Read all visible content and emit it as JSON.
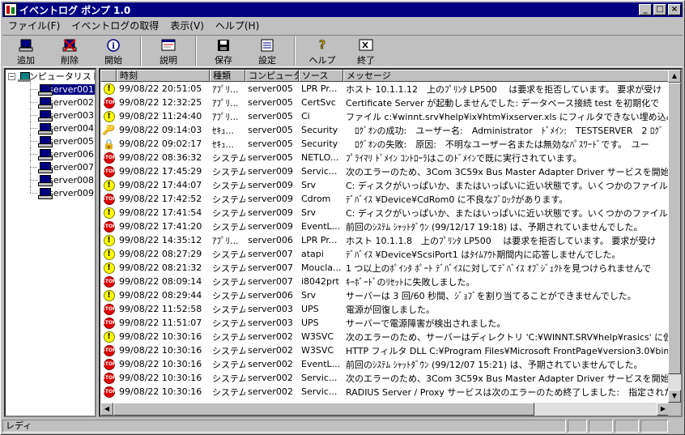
{
  "app": {
    "title": "イベントログ ポンプ 1.0"
  },
  "window_controls": [
    "_",
    "□",
    "×"
  ],
  "menubar": [
    "ファイル(F)",
    "イベントログの取得",
    "表示(V)",
    "ヘルプ(H)"
  ],
  "toolbar": [
    {
      "label": "追加",
      "icon": "add-computer-icon"
    },
    {
      "label": "削除",
      "icon": "delete-computer-icon"
    },
    {
      "label": "開始",
      "icon": "start-info-icon"
    },
    {
      "label": "説明",
      "icon": "description-icon"
    },
    {
      "label": "保存",
      "icon": "save-disk-icon"
    },
    {
      "label": "設定",
      "icon": "settings-icon"
    },
    {
      "label": "ヘルプ",
      "icon": "help-icon"
    },
    {
      "label": "終了",
      "icon": "exit-icon"
    }
  ],
  "tree": {
    "root": "コンピュータリスト",
    "items": [
      "server001",
      "server002",
      "server003",
      "server004",
      "server005",
      "server006",
      "server007",
      "server008",
      "server009"
    ],
    "selected": "server001"
  },
  "columns": [
    "",
    "時刻",
    "種類",
    "コンピュータ名",
    "ソース",
    "メッセージ"
  ],
  "rows": [
    {
      "icon": "warn",
      "time": "99/08/22 20:51:05",
      "type": "ｱﾌﾟﾘ...",
      "computer": "server005",
      "source": "LPR Pr...",
      "message": "ホスト 10.1.1.12　上のﾌﾟﾘﾝﾀ LP500　 は要求を拒否しています。 要求が受け"
    },
    {
      "icon": "err",
      "time": "99/08/22 12:32:25",
      "type": "ｱﾌﾟﾘ...",
      "computer": "server005",
      "source": "CertSvc",
      "message": "Certificate Server が起動しませんでした: データベース接続 test を初期化で"
    },
    {
      "icon": "warn",
      "time": "99/08/22 11:24:40",
      "type": "ｱﾌﾟﾘ...",
      "computer": "server005",
      "source": "Ci",
      "message": "ファイル c:¥winnt.srv¥help¥ix¥htm¥ixserver.xls にフィルタできない埋め込みが"
    },
    {
      "icon": "key",
      "time": "99/08/22 09:14:03",
      "type": "ｾｷｭ...",
      "computer": "server005",
      "source": "Security",
      "message": "　ﾛｸﾞｵﾝの成功:　ユーザー名:　Administrator　ﾄﾞﾒｲﾝ:　TESTSERVER　2 ﾛｸﾞ"
    },
    {
      "icon": "lock",
      "time": "99/08/22 09:02:17",
      "type": "ｾｷｭ...",
      "computer": "server005",
      "source": "Security",
      "message": "　ﾛｸﾞｵﾝの失敗:　原因:　不明なユーザー名または無効なﾊﾟｽﾜｰﾄﾞです。　ユー"
    },
    {
      "icon": "err",
      "time": "99/08/22 08:36:32",
      "type": "システム",
      "computer": "server005",
      "source": "NETLO...",
      "message": "ﾌﾟﾗｲﾏﾘ ﾄﾞﾒｲﾝ ｺﾝﾄﾛｰﾗはこのﾄﾞﾒｲﾝで既に実行されています。"
    },
    {
      "icon": "err",
      "time": "99/08/22 17:45:29",
      "type": "システム",
      "computer": "server009",
      "source": "Servic...",
      "message": "次のエラーのため、3Com 3C59x Bus Master Adapter Driver サービスを開始できま"
    },
    {
      "icon": "warn",
      "time": "99/08/22 17:44:07",
      "type": "システム",
      "computer": "server009",
      "source": "Srv",
      "message": "C: ディスクがいっぱいか、またはいっぱいに近い状態です。いくつかのファイルを削除"
    },
    {
      "icon": "err",
      "time": "99/08/22 17:42:52",
      "type": "システム",
      "computer": "server009",
      "source": "Cdrom",
      "message": "ﾃﾞﾊﾞｲｽ ¥Device¥CdRom0 に不良なﾌﾞﾛｯｸがあります。"
    },
    {
      "icon": "warn",
      "time": "99/08/22 17:41:54",
      "type": "システム",
      "computer": "server009",
      "source": "Srv",
      "message": "C: ディスクがいっぱいか、またはいっぱいに近い状態です。いくつかのファイルを削除"
    },
    {
      "icon": "err",
      "time": "99/08/22 17:41:20",
      "type": "システム",
      "computer": "server009",
      "source": "EventL...",
      "message": "前回のｼｽﾃﾑ ｼｬｯﾄﾀﾞｳﾝ (99/12/17 19:18) は、予期されていませんでした。"
    },
    {
      "icon": "warn",
      "time": "99/08/22 14:35:12",
      "type": "ｱﾌﾟﾘ...",
      "computer": "server006",
      "source": "LPR Pr...",
      "message": "ホスト 10.1.1.8　上のﾌﾟﾘﾝﾀ LP500　 は要求を拒否しています。 要求が受け"
    },
    {
      "icon": "warn",
      "time": "99/08/22 08:27:29",
      "type": "システム",
      "computer": "server007",
      "source": "atapi",
      "message": "ﾃﾞﾊﾞｲｽ ¥Device¥ScsiPort1 はﾀｲﾑｱｳﾄ期間内に応答しませんでした。"
    },
    {
      "icon": "warn",
      "time": "99/08/22 08:21:32",
      "type": "システム",
      "computer": "server007",
      "source": "Moucla...",
      "message": "1 つ以上のﾎﾟｲﾝﾀ ﾎﾟｰﾄ ﾃﾞﾊﾞｲｽに対してﾃﾞﾊﾞｲｽ ｵﾌﾞｼﾞｪｸﾄを見つけられませんで"
    },
    {
      "icon": "err",
      "time": "99/08/22 08:09:14",
      "type": "システム",
      "computer": "server007",
      "source": "i8042prt",
      "message": "ｷｰﾎﾞｰﾄﾞのﾘｾｯﾄに失敗しました。"
    },
    {
      "icon": "warn",
      "time": "99/08/22 08:29:44",
      "type": "システム",
      "computer": "server006",
      "source": "Srv",
      "message": "サーバーは 3 回/60 秒間、ｼﾞｮﾌﾞを割り当てることができませんでした。"
    },
    {
      "icon": "err",
      "time": "99/08/22 11:52:58",
      "type": "システム",
      "computer": "server003",
      "source": "UPS",
      "message": "電源が回復しました。"
    },
    {
      "icon": "err",
      "time": "99/08/22 11:51:07",
      "type": "システム",
      "computer": "server003",
      "source": "UPS",
      "message": "サーバーで電源障害が検出されました。"
    },
    {
      "icon": "warn",
      "time": "99/08/22 10:30:16",
      "type": "システム",
      "computer": "server002",
      "source": "W3SVC",
      "message": "次のエラーのため、サーバーはディレクトリ 'C:¥WINNT.SRV¥help¥rasics' に仮想"
    },
    {
      "icon": "err",
      "time": "99/08/22 10:30:16",
      "type": "システム",
      "computer": "server002",
      "source": "W3SVC",
      "message": "HTTP フィルタ DLL C:¥Program Files¥Microsoft FrontPage¥version3.0¥bin¥fpe"
    },
    {
      "icon": "err",
      "time": "99/08/22 10:30:16",
      "type": "システム",
      "computer": "server002",
      "source": "EventL...",
      "message": "前回のｼｽﾃﾑ ｼｬｯﾄﾀﾞｳﾝ (99/12/07 15:21) は、予期されていませんでした。"
    },
    {
      "icon": "err",
      "time": "99/08/22 10:30:16",
      "type": "システム",
      "computer": "server002",
      "source": "Servic...",
      "message": "次のエラーのため、3Com 3C59x Bus Master Adapter Driver サービスを開始できま"
    },
    {
      "icon": "err",
      "time": "99/08/22 10:30:16",
      "type": "システム",
      "computer": "server002",
      "source": "Servic...",
      "message": "RADIUS Server / Proxy サービスは次のエラーのため終了しました:　指定されたフ"
    }
  ],
  "status": {
    "text": "レディ"
  }
}
